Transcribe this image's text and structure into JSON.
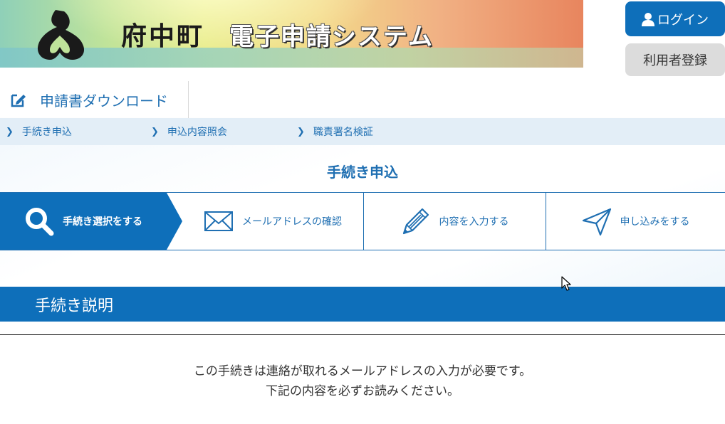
{
  "header": {
    "town_name": "府中町",
    "system_name": "電子申請システム",
    "logo_icon": "town-emblem-icon"
  },
  "account": {
    "login_label": "ログイン",
    "login_icon": "user-icon",
    "register_label": "利用者登録"
  },
  "download": {
    "label": "申請書ダウンロード",
    "icon": "edit-document-icon"
  },
  "nav": {
    "items": [
      {
        "label": "手続き申込"
      },
      {
        "label": "申込内容照会"
      },
      {
        "label": "職責署名検証"
      }
    ]
  },
  "main": {
    "title": "手続き申込",
    "steps": [
      {
        "label": "手続き選択をする",
        "icon": "search-icon",
        "active": true
      },
      {
        "label": "メールアドレスの確認",
        "icon": "mail-icon",
        "active": false
      },
      {
        "label": "内容を入力する",
        "icon": "pencil-icon",
        "active": false
      },
      {
        "label": "申し込みをする",
        "icon": "send-icon",
        "active": false
      }
    ],
    "section_title": "手続き説明",
    "description_lines": [
      "この手続きは連絡が取れるメールアドレスの入力が必要です。",
      "下記の内容を必ずお読みください。"
    ]
  },
  "colors": {
    "primary": "#0e6fba",
    "link": "#1f6fb2",
    "nav_bg": "#e3eef7",
    "register_bg": "#dcdcdc"
  }
}
